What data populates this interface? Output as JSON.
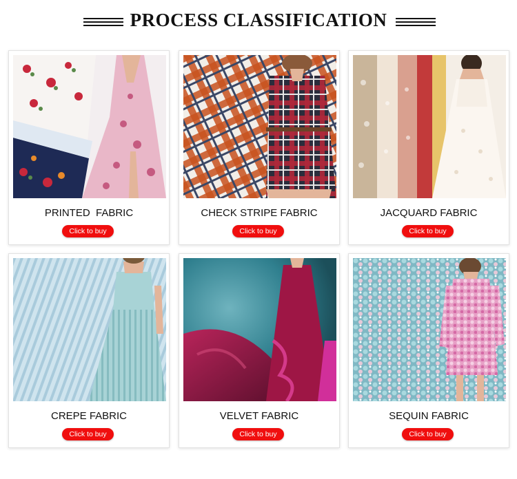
{
  "page": {
    "title": "PROCESS CLASSIFICATION"
  },
  "cards": [
    {
      "label": "PRINTED  FABRIC",
      "button": "Click to buy",
      "image": "floral-printed-dress"
    },
    {
      "label": "CHECK STRIPE FABRIC",
      "button": "Click to buy",
      "image": "plaid-shirt-dress"
    },
    {
      "label": "JACQUARD FABRIC",
      "button": "Click to buy",
      "image": "jacquard-gown"
    },
    {
      "label": "CREPE FABRIC",
      "button": "Click to buy",
      "image": "pleated-crepe-dress"
    },
    {
      "label": "VELVET FABRIC",
      "button": "Click to buy",
      "image": "velvet-ruffle-dress"
    },
    {
      "label": "SEQUIN FABRIC",
      "button": "Click to buy",
      "image": "sequin-dress"
    }
  ],
  "colors": {
    "button_bg": "#f00e0e",
    "button_text": "#ffffff",
    "title_text": "#111111"
  }
}
